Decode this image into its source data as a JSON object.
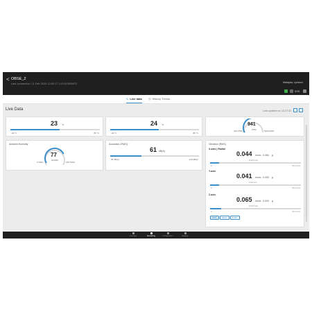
{
  "header": {
    "back_glyph": "<",
    "title": "OBSE_2",
    "subtitle": "Last connection: 11 Feb 2024 12:00:17 | ID:SO0000P2",
    "account": "Malaysia, Lyndons",
    "status_text": "SOS"
  },
  "tabs": [
    {
      "label": "Live data",
      "active": true
    },
    {
      "label": "History Trends",
      "active": false
    }
  ],
  "live": {
    "title": "Live Data",
    "updated": "Last updated on: 13:27:32"
  },
  "cards": {
    "temp1": {
      "value": "23",
      "unit": "°c",
      "min": "-40 °C",
      "max": "85 °C",
      "fill": 0.55
    },
    "temp2": {
      "value": "24",
      "unit": "°c",
      "min": "-40 °C",
      "max": "85 °C",
      "fill": 0.55
    },
    "co2": {
      "value": "941",
      "unit": "PPM",
      "min": "400 PPM",
      "max": "5000 PPM",
      "fill": 0.45
    },
    "humidity": {
      "title": "Ambient Humidity",
      "value": "77",
      "unit": "%",
      "status": "HUMID",
      "min": "0 %RH",
      "max": "100 %RH",
      "fill": 0.77
    },
    "acoustic": {
      "title": "Acoustics LPAEQ",
      "value": "61",
      "unit": "dB(A)",
      "min": "35 dB(A)",
      "max": "120 dB(A)",
      "fill": 0.35
    },
    "vibration": {
      "title": "Vibration (RMS)",
      "rows": [
        {
          "label": "X-axis | Radial",
          "value": "0.044",
          "unit": "mm/s",
          "peak": "0.054",
          "peak_unit": "g",
          "note": "0.024 G/s",
          "fill": 0.1
        },
        {
          "label": "Y-axis",
          "value": "0.041",
          "unit": "mm/s",
          "peak": "0.003",
          "peak_unit": "g",
          "note": "0.29 G/s",
          "fill": 0.1
        },
        {
          "label": "Z-axis",
          "value": "0.065",
          "unit": "mm/s",
          "peak": "0.003",
          "peak_unit": "g",
          "note": "0.024 G/s",
          "fill": 0.12
        }
      ],
      "range_min": "0",
      "range_max": "50 mm/s",
      "pills": [
        "RMS",
        "PEAK",
        "KURT"
      ]
    }
  },
  "bottom_nav": [
    {
      "label": "Overview",
      "active": false
    },
    {
      "label": "Monitoring",
      "active": true
    },
    {
      "label": "Configuration",
      "active": false
    },
    {
      "label": "Settings",
      "active": false
    }
  ],
  "colors": {
    "accent": "#3a8ec9",
    "header_bg": "#1f1f1f",
    "status_green": "#3fae49"
  }
}
